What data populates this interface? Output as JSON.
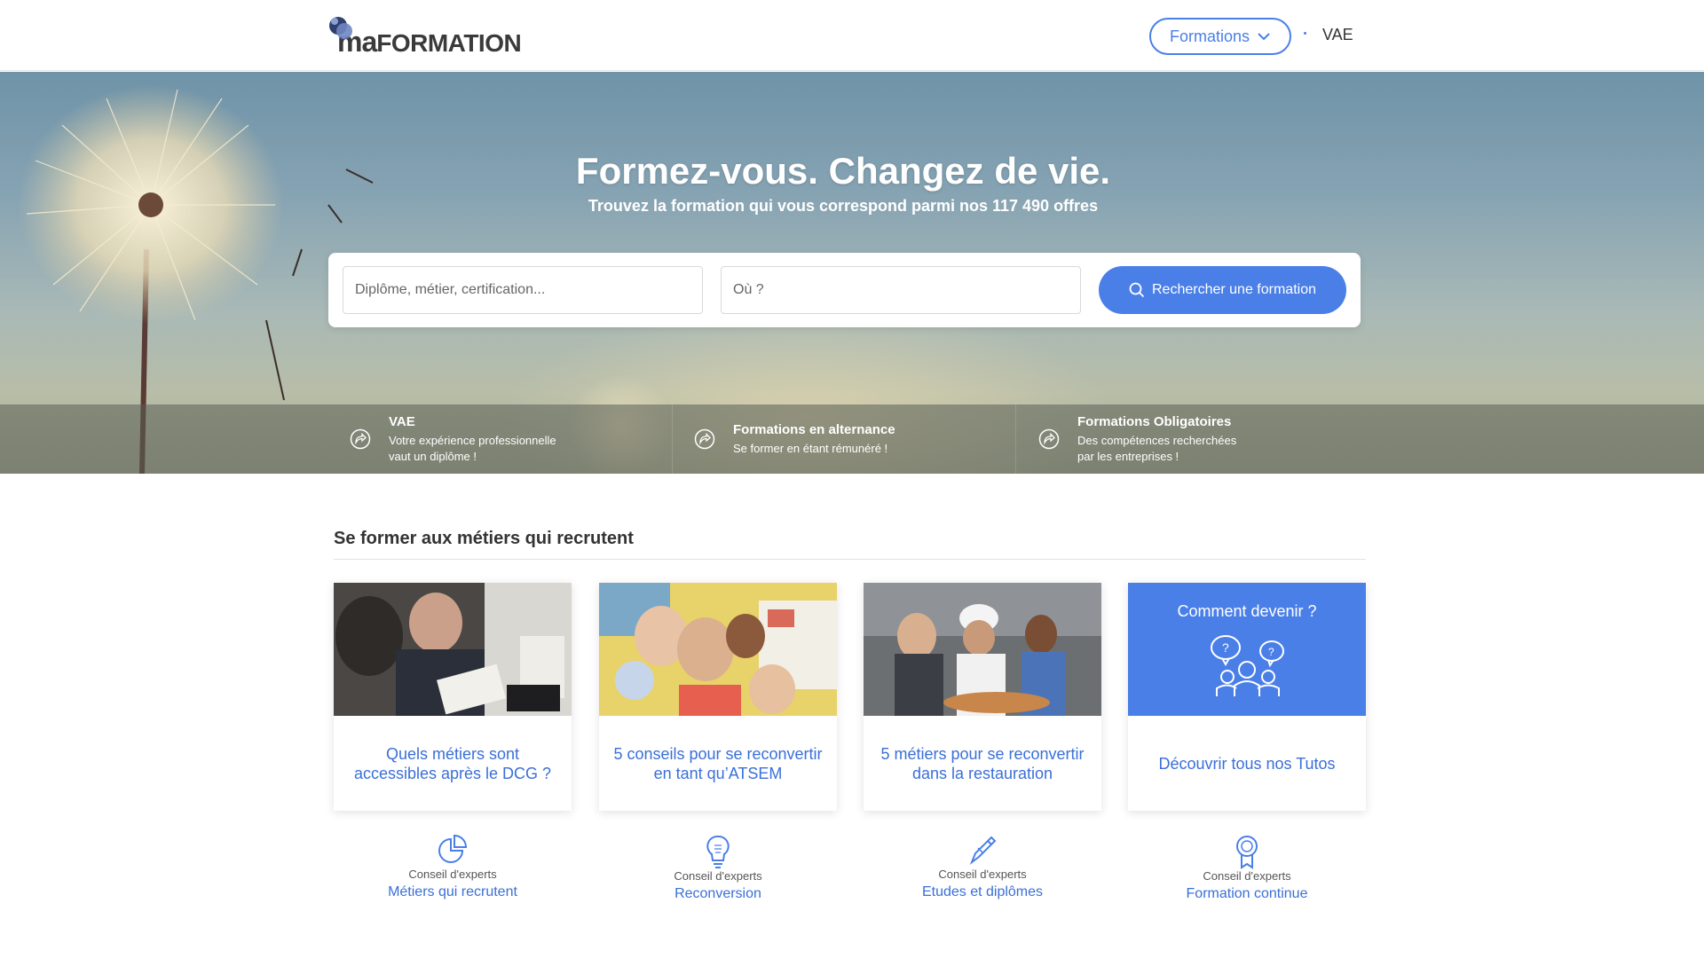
{
  "header": {
    "logo_text_ma": "ma",
    "logo_text_formation": "FORMATION",
    "nav_formations": "Formations",
    "nav_vae": "VAE"
  },
  "hero": {
    "title": "Formez-vous. Changez de vie.",
    "subtitle": "Trouvez la formation qui vous correspond parmi nos 117 490 offres",
    "search": {
      "what_placeholder": "Diplôme, métier, certification...",
      "where_placeholder": "Où ?",
      "button_label": "Rechercher une formation"
    },
    "band": [
      {
        "title": "VAE",
        "desc_line1": "Votre expérience professionnelle",
        "desc_line2": "vaut un diplôme !"
      },
      {
        "title": "Formations en alternance",
        "desc_line1": "Se former en étant rémunéré !",
        "desc_line2": ""
      },
      {
        "title": "Formations Obligatoires",
        "desc_line1": "Des compétences recherchées",
        "desc_line2": "par les entreprises !"
      }
    ]
  },
  "section": {
    "title": "Se former aux métiers qui recrutent",
    "cards": [
      {
        "text": "Quels métiers sont accessibles après le DCG ?"
      },
      {
        "text": "5 conseils pour se reconvertir en tant qu’ATSEM"
      },
      {
        "text": "5 métiers pour se reconvertir dans la restauration"
      },
      {
        "title": "Comment devenir ?",
        "text": "Découvrir tous nos Tutos"
      }
    ],
    "experts": [
      {
        "small": "Conseil d'experts",
        "link": "Métiers qui recrutent",
        "icon": "pie-chart-icon"
      },
      {
        "small": "Conseil d'experts",
        "link": "Reconversion",
        "icon": "lightbulb-icon"
      },
      {
        "small": "Conseil d'experts",
        "link": "Etudes et diplômes",
        "icon": "pen-icon"
      },
      {
        "small": "Conseil d'experts",
        "link": "Formation continue",
        "icon": "award-icon"
      }
    ]
  },
  "colors": {
    "accent": "#4a7fe8",
    "link": "#3a6fd8"
  }
}
